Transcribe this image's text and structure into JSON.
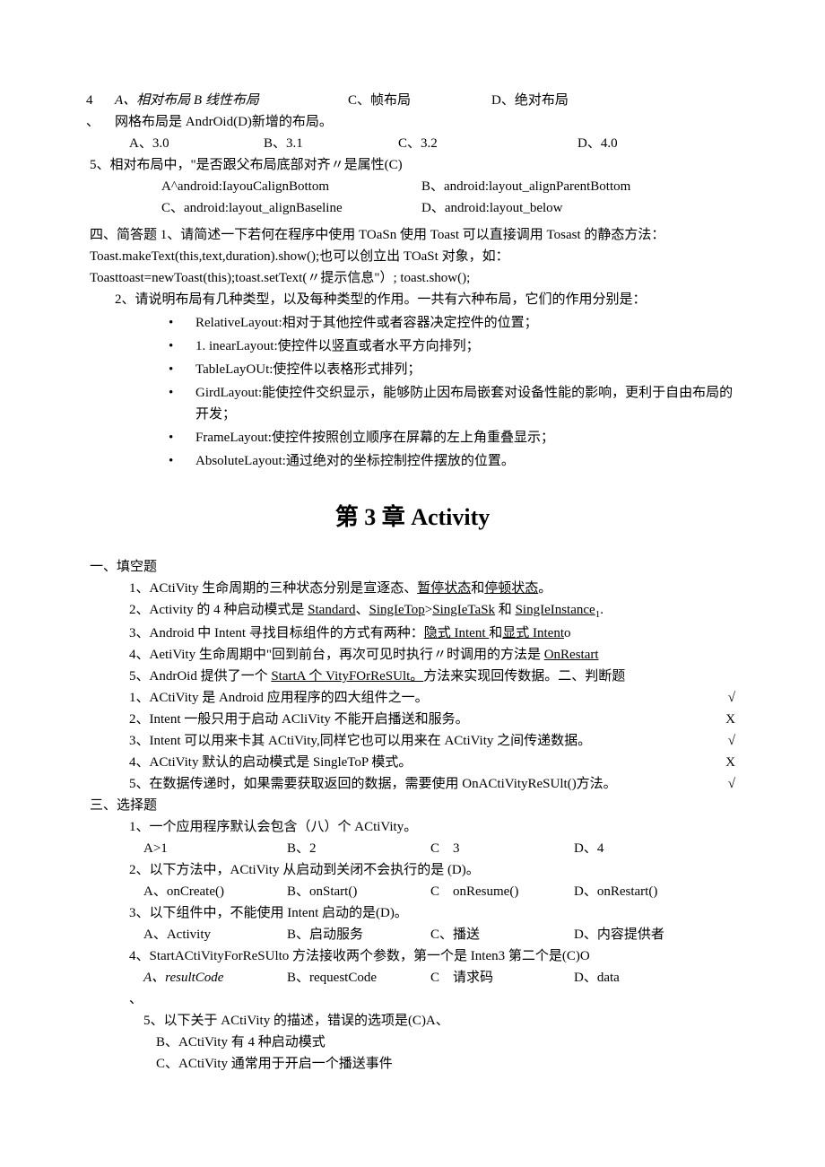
{
  "q4": {
    "num_top": "4",
    "opt_a": "A、相对布局 B 线性布局",
    "opt_c": "C、帧布局",
    "opt_d": "D、绝对布局",
    "line2_prefix": "、",
    "line2": "网格布局是 AndrOid(D)新增的布局。",
    "opts2_a": "A、3.0",
    "opts2_b": "B、3.1",
    "opts2_c": "C、3.2",
    "opts2_d": "D、4.0"
  },
  "q5": {
    "stem": "5、相对布局中，\"是否跟父布局底部对齐〃是属性(C)",
    "a": "A^android:IayouCalignBottom",
    "b": "B、android:layout_alignParentBottom",
    "c": "C、android:layout_alignBaseline",
    "d": "D、android:layout_below"
  },
  "short": {
    "l1": "四、简答题 1、请简述一下若何在程序中使用 TOaSn 使用 Toast 可以直接调用 Tosast 的静态方法：",
    "l2": "Toast.makeText(this,text,duration).show();也可以创立出 TOaSt 对象，如：",
    "l3": "Toasttoast=newToast(this);toast.setText(〃提示信息\"）; toast.show();",
    "l4": "2、请说明布局有几种类型，以及每种类型的作用。一共有六种布局，它们的作用分别是：",
    "b1": "RelativeLayout:相对于其他控件或者容器决定控件的位置；",
    "b2": "1. inearLayout:使控件以竖直或者水平方向排列；",
    "b3": "TableLayOUt:使控件以表格形式排列；",
    "b4": "GirdLayout:能使控件交织显示，能够防止因布局嵌套对设备性能的影响，更利于自由布局的开发；",
    "b5": "FrameLayout:使控件按照创立顺序在屏幕的左上角重叠显示；",
    "b6": "AbsoluteLayout:通过绝对的坐标控制控件摆放的位置。"
  },
  "chapter": "第 3 章 Activity",
  "fill": {
    "head": "一、填空题",
    "i1_a": "1、ACtiVity 生命周期的三种状态分别是宣逐态、",
    "i1_u1": "暂停状态",
    "i1_b": "和",
    "i1_u2": "停顿状态",
    "i1_c": "。",
    "i2_a": "2、Activity 的 4 种启动模式是 ",
    "i2_u1": "Standard",
    "i2_s1": "、",
    "i2_u2": "SingIeTop",
    "i2_s2": ">",
    "i2_u3": "SingIeTaSk",
    "i2_s3": " 和 ",
    "i2_u4": "SingIeInstance",
    "i2_sub": "1",
    "i2_end": ".",
    "i3_a": "3、Android 中 Intent 寻找目标组件的方式有两种：",
    "i3_u1": "隐式 Intent ",
    "i3_b": "和",
    "i3_u2": "显式 Intent",
    "i3_c": "o",
    "i4_a": "4、AetiVity 生命周期中\"回到前台，再次可见时执行〃时调用的方法是 ",
    "i4_u": "OnRestart",
    "i5_a": "5、AndrOid 提供了一个 ",
    "i5_u": "StartA 个 VityFOrReSUlt。",
    "i5_b": "方法来实现回传数据。二、判断题"
  },
  "judge": {
    "j1": "1、ACtiVity 是 Android 应用程序的四大组件之一。",
    "m1": "√",
    "j2": "2、Intent 一般只用于启动 ACliVity 不能开启播送和服务。",
    "m2": "X",
    "j3": "3、Intent 可以用来卡其 ACtiVity,同样它也可以用来在 ACtiVity 之间传递数据。",
    "m3": "√",
    "j4": "4、ACtiVity 默认的启动模式是 SingleToP 模式。",
    "m4": "X",
    "j5": "5、在数据传递时，如果需要获取返回的数据，需要使用 OnACtiVityReSUlt()方法。",
    "m5": "√"
  },
  "choice": {
    "head": "三、选择题",
    "q1": "1、一个应用程序默认会包含（八）个 ACtiVity。",
    "q1a": "A>1",
    "q1b": "B、2",
    "q1c": "C    3",
    "q1d": "D、4",
    "q2": "2、以下方法中，ACtiVity 从启动到关闭不会执行的是  (D)。",
    "q2a": "A、onCreate()",
    "q2b": "B、onStart()",
    "q2c": "C    onResume()",
    "q2d": "D、onRestart()",
    "q3": "3、以下组件中，不能使用 Intent 启动的是(D)。",
    "q3a": "A、Activity",
    "q3b": "B、启动服务",
    "q3c": "C、播送",
    "q3d": "D、内容提供者",
    "q4": "4、StartACtiVityForReSUlto 方法接收两个参数，第一个是 Inten3 第二个是(C)O",
    "q4a": "A、resultCode",
    "q4b": "B、requestCode",
    "q4c": "C    请求码",
    "q4d": "D、data",
    "q4tail": "、",
    "q5": "5、以下关于 ACtiVity 的描述，错误的选项是(C)A、",
    "q5b": "B、ACtiVity 有 4 种启动模式",
    "q5c": "C、ACtiVity 通常用于开启一个播送事件"
  }
}
